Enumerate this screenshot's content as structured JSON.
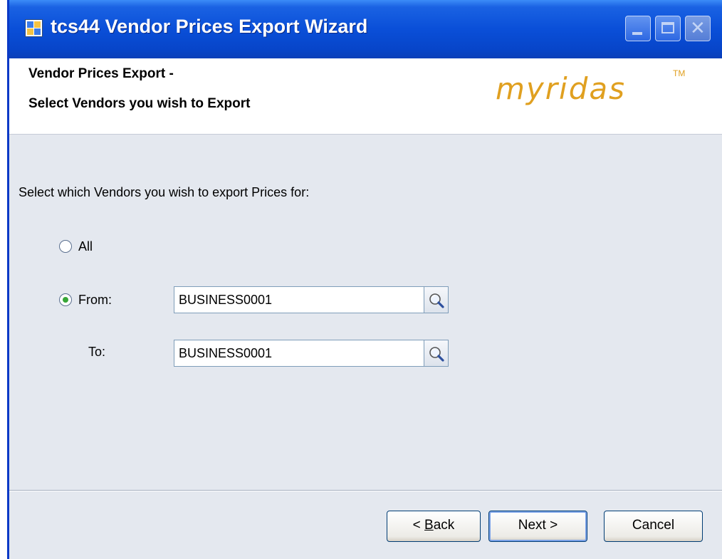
{
  "window": {
    "title": "tcs44 Vendor Prices Export Wizard"
  },
  "header": {
    "line1": "Vendor Prices Export -",
    "line2": "Select Vendors you wish to Export",
    "logo": "myridas",
    "logo_tm": "TM",
    "logo_color": "#e0a020"
  },
  "main": {
    "instruction": "Select which Vendors you wish to export Prices for:",
    "option_all_label": "All",
    "option_from_label": "From:",
    "to_label": "To:",
    "from_value": "BUSINESS0001",
    "to_value": "BUSINESS0001",
    "selected_option": "From"
  },
  "footer": {
    "back_prefix": "< ",
    "back_mnemonic": "B",
    "back_rest": "ack",
    "next_label": "Next >",
    "cancel_label": "Cancel"
  },
  "colors": {
    "titlebar": "#0a4fd8",
    "body": "#e4e8ef",
    "radio_dot": "#37a637"
  }
}
